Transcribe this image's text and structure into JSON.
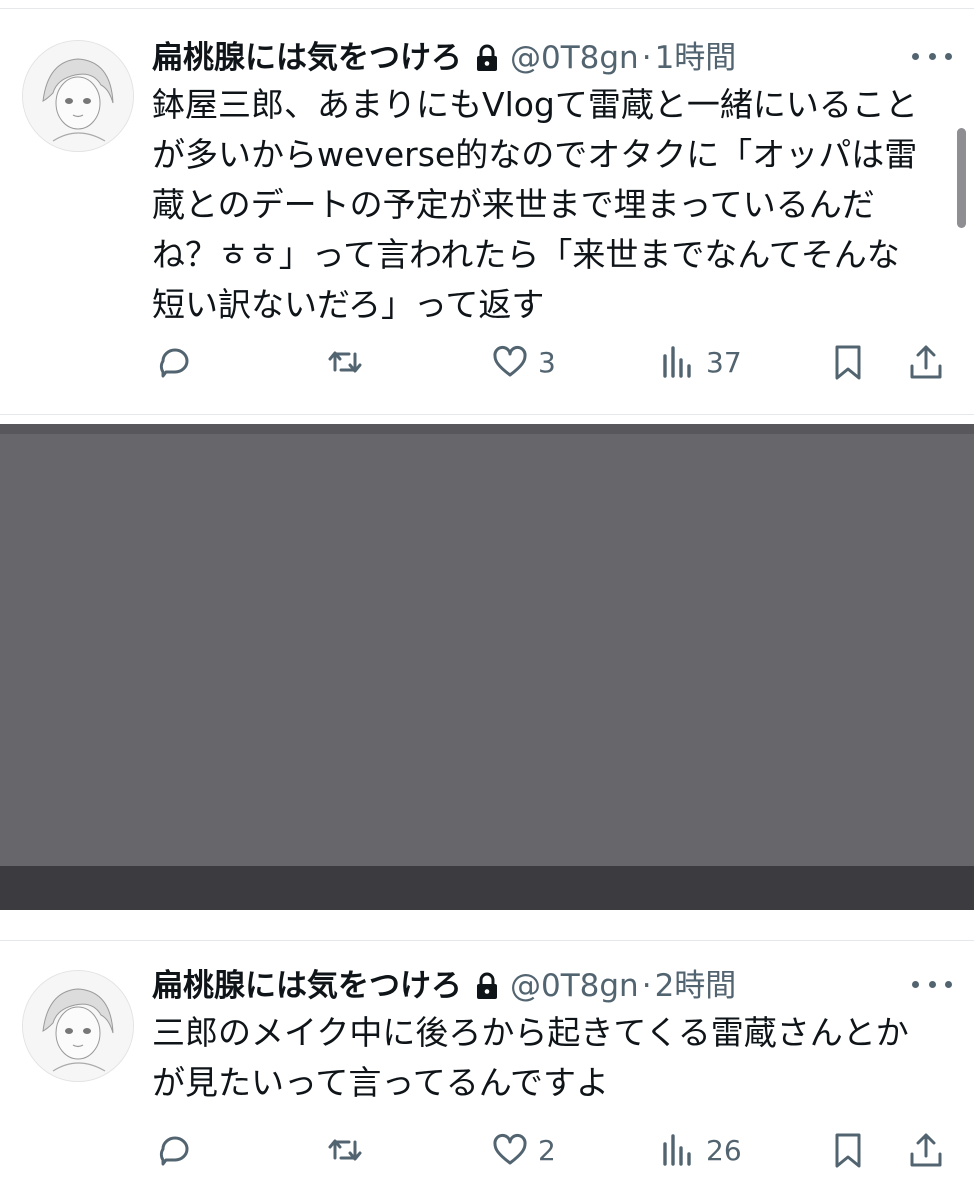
{
  "tweets": [
    {
      "display_name": "扁桃腺には気をつけろ",
      "handle": "@0T8gn",
      "separator": "·",
      "time": "1時間",
      "text": "鉢屋三郎、あまりにもVlogて雷蔵と一緒にいることが多いからweverse的なのでオタクに「オッパは雷蔵とのデートの予定が来世まで埋まっているんだね？ㅎㅎ」って言われたら「来世までなんてそんな短い訳ないだろ」って返す",
      "actions": {
        "reply_count": "",
        "retweet_count": "",
        "like_count": "3",
        "views_count": "37"
      }
    },
    {
      "display_name": "扁桃腺には気をつけろ",
      "handle": "@0T8gn",
      "separator": "·",
      "time": "2時間",
      "text": "三郎のメイク中に後ろから起きてくる雷蔵さんとかが見たいって言ってるんですよ",
      "actions": {
        "reply_count": "",
        "retweet_count": "",
        "like_count": "2",
        "views_count": "26"
      }
    }
  ],
  "icons": [
    "lock-icon",
    "more-icon",
    "reply-icon",
    "retweet-icon",
    "like-icon",
    "views-icon",
    "bookmark-icon",
    "share-icon"
  ],
  "colors": {
    "text": "#0f1419",
    "secondary": "#536471",
    "divider": "#e6e9ec",
    "media": "#67676b"
  }
}
